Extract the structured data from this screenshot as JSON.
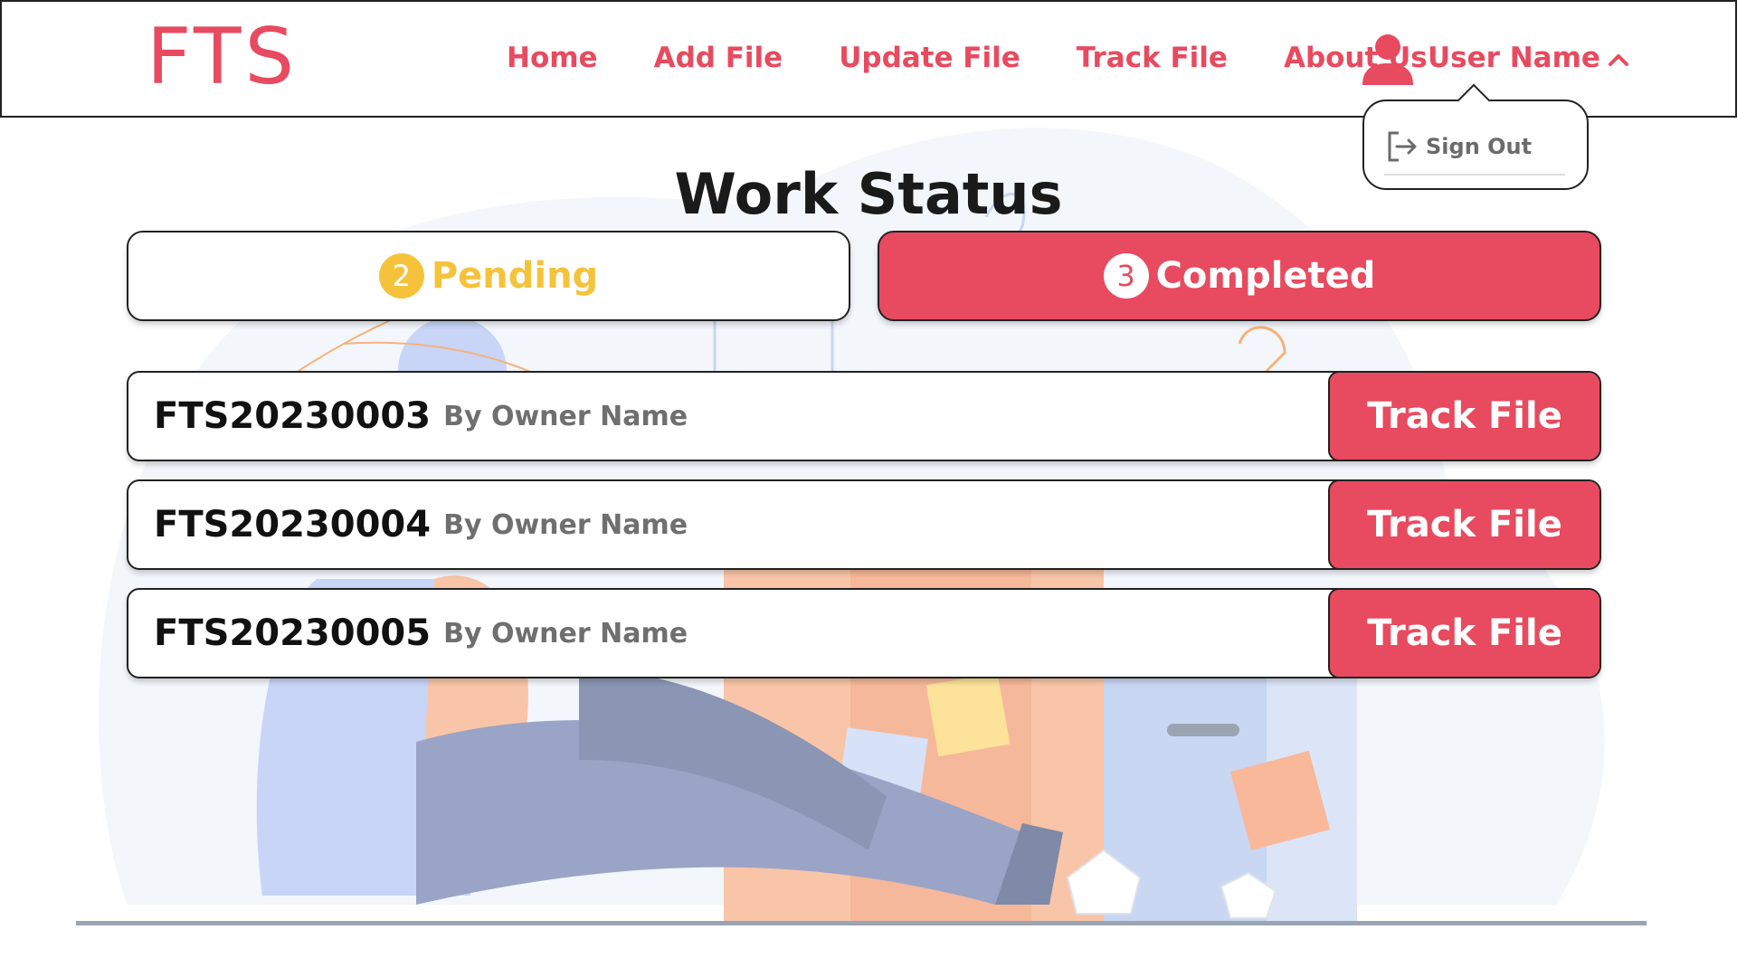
{
  "brand": "FTS",
  "nav": {
    "links": [
      "Home",
      "Add File",
      "Update File",
      "Track File",
      "About Us"
    ],
    "user_name": "User Name"
  },
  "dropdown": {
    "sign_out": "Sign Out"
  },
  "page_title": "Work Status",
  "tabs": {
    "pending": {
      "count": "2",
      "label": "Pending"
    },
    "completed": {
      "count": "3",
      "label": "Completed"
    }
  },
  "files": [
    {
      "id": "FTS20230003",
      "owner": "By Owner Name",
      "action": "Track File"
    },
    {
      "id": "FTS20230004",
      "owner": "By Owner Name",
      "action": "Track File"
    },
    {
      "id": "FTS20230005",
      "owner": "By Owner Name",
      "action": "Track File"
    }
  ],
  "colors": {
    "accent": "#e84a5f",
    "pending": "#f5c33b"
  }
}
